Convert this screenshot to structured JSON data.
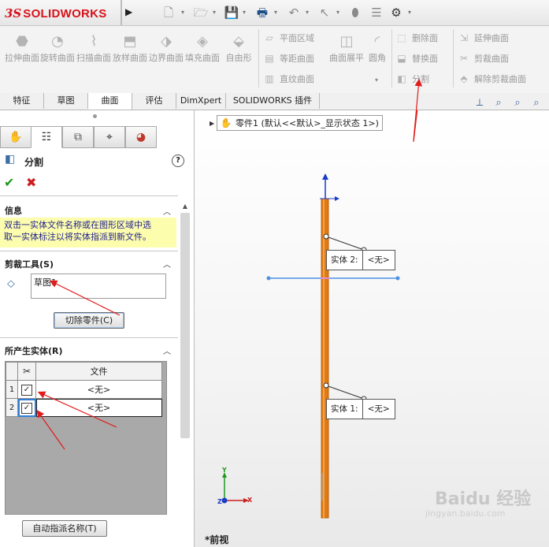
{
  "app": {
    "logo_prefix": "3S",
    "logo_text": "SOLIDWORKS"
  },
  "quick_toolbar": {
    "icons": [
      "new-document-icon",
      "open-icon",
      "save-icon",
      "print-icon",
      "undo-icon",
      "select-icon",
      "rebuild-icon",
      "file-properties-icon",
      "options-icon"
    ]
  },
  "ribbon": {
    "large_buttons": [
      {
        "label": "拉伸曲面",
        "icon": "extruded-surface-icon"
      },
      {
        "label": "旋转曲面",
        "icon": "revolved-surface-icon"
      },
      {
        "label": "扫描曲面",
        "icon": "swept-surface-icon"
      },
      {
        "label": "放样曲面",
        "icon": "lofted-surface-icon"
      },
      {
        "label": "边界曲面",
        "icon": "boundary-surface-icon"
      },
      {
        "label": "填充曲面",
        "icon": "filled-surface-icon"
      },
      {
        "label": "自由形",
        "icon": "freeform-icon"
      }
    ],
    "group2": [
      {
        "label": "平面区域",
        "icon": "planar-surface-icon"
      },
      {
        "label": "等距曲面",
        "icon": "offset-surface-icon"
      },
      {
        "label": "直纹曲面",
        "icon": "ruled-surface-icon"
      }
    ],
    "group2_large": [
      {
        "label": "曲面展平",
        "icon": "surface-flatten-icon"
      },
      {
        "label": "圆角",
        "icon": "fillet-icon"
      }
    ],
    "group3": [
      {
        "label": "删除面",
        "icon": "delete-face-icon"
      },
      {
        "label": "替换面",
        "icon": "replace-face-icon"
      },
      {
        "label": "分割",
        "icon": "split-icon"
      }
    ],
    "group4": [
      {
        "label": "延伸曲面",
        "icon": "extend-surface-icon"
      },
      {
        "label": "剪裁曲面",
        "icon": "trim-surface-icon"
      },
      {
        "label": "解除剪裁曲面",
        "icon": "untrim-surface-icon"
      }
    ]
  },
  "command_tabs": [
    {
      "label": "特征",
      "active": false
    },
    {
      "label": "草图",
      "active": false
    },
    {
      "label": "曲面",
      "active": true
    },
    {
      "label": "评估",
      "active": false
    },
    {
      "label": "DimXpert",
      "active": false
    },
    {
      "label": "SOLIDWORKS 插件",
      "active": false
    }
  ],
  "property_manager": {
    "tab_icons": [
      "feature-manager-icon",
      "property-manager-icon",
      "configuration-manager-icon",
      "dimxpert-manager-icon",
      "display-manager-icon"
    ],
    "title": "分割",
    "help_label": "?",
    "ok_label": "✔",
    "cancel_label": "✖",
    "info": {
      "title": "信息",
      "text_line1": "双击一实体文件名称或在图形区域中选",
      "text_line2": "取一实体标注以将实体指派到新文件。"
    },
    "trim_tools": {
      "title": "剪裁工具(S)",
      "items": [
        "草图1"
      ],
      "cut_button": "切除零件(C)"
    },
    "resulting_bodies": {
      "title": "所产生实体(R)",
      "column_file": "文件",
      "rows": [
        {
          "num": "1",
          "checked": true,
          "file": "<无>"
        },
        {
          "num": "2",
          "checked": true,
          "file": "<无>"
        }
      ]
    },
    "auto_assign_button": "自动指派名称(T)"
  },
  "graphics": {
    "tree_node": "零件1  (默认<<默认>_显示状态 1>)",
    "callouts": [
      {
        "label": "实体  2:",
        "value": "<无>"
      },
      {
        "label": "实体  1:",
        "value": "<无>"
      }
    ],
    "axes": {
      "x": "X",
      "y": "Y",
      "z": "Z"
    },
    "view_label": "*前视",
    "watermark": "Baidu 经验",
    "watermark_sub": "jingyan.baidu.com"
  },
  "colors": {
    "body_orange": "#e07a12",
    "sketch_blue": "#4a90e2",
    "annotation_red": "#e31b1b",
    "info_bg": "#fdfdae"
  }
}
